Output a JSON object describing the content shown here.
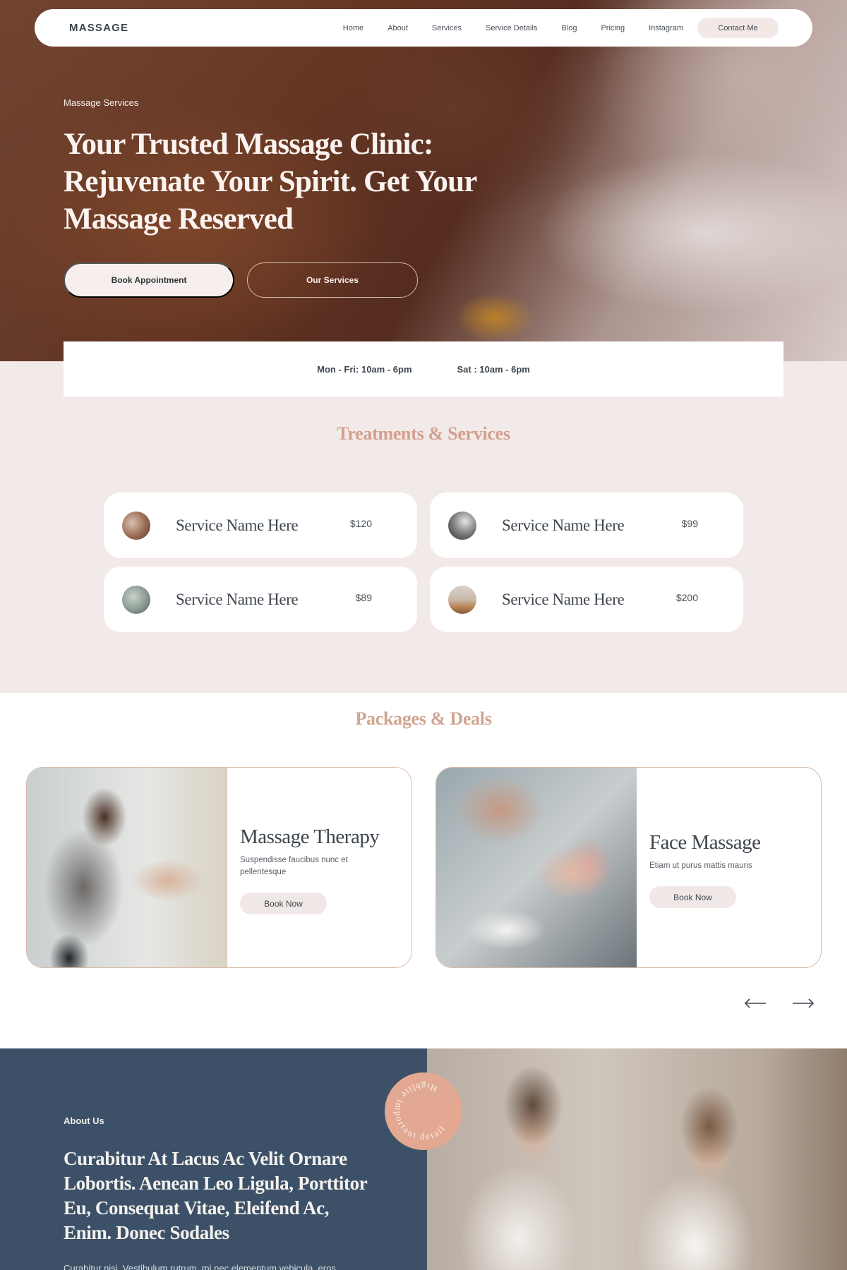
{
  "nav": {
    "logo": "MASSAGE",
    "links": [
      "Home",
      "About",
      "Services",
      "Service Details",
      "Blog",
      "Pricing",
      "Instagram"
    ],
    "contact_label": "Contact Me"
  },
  "hero": {
    "eyebrow": "Massage Services",
    "title": "Your Trusted Massage Clinic: Rejuvenate Your Spirit. Get Your Massage Reserved",
    "primary_button": "Book Appointment",
    "secondary_button": "Our Services"
  },
  "hours": {
    "weekday": "Mon - Fri: 10am - 6pm",
    "saturday": "Sat : 10am - 6pm"
  },
  "treatments": {
    "title": "Treatments & Services",
    "items": [
      {
        "name": "Service Name Here",
        "price": "$120",
        "thumb_color": "#9a6a52"
      },
      {
        "name": "Service Name Here",
        "price": "$99",
        "thumb_color": "#5d5f62"
      },
      {
        "name": "Service Name Here",
        "price": "$89",
        "thumb_color": "#8a9a92"
      },
      {
        "name": "Service Name Here",
        "price": "$200",
        "thumb_color": "#b98455"
      }
    ]
  },
  "packages": {
    "title": "Packages & Deals",
    "items": [
      {
        "name": "Massage Therapy",
        "description": "Suspendisse faucibus nunc et pellentesque",
        "button": "Book Now"
      },
      {
        "name": "Face Massage",
        "description": "Etiam ut purus mattis mauris",
        "button": "Book Now"
      }
    ],
    "prev_icon": "arrow-left-icon",
    "next_icon": "arrow-right-icon"
  },
  "about": {
    "eyebrow": "About Us",
    "title": "Curabitur At Lacus Ac Velit Ornare Lobortis. Aenean Leo Ligula, Porttitor Eu, Consequat Vitae, Eleifend Ac, Enim. Donec Sodales",
    "body": "Curabitur nisi. Vestibulum rutrum, mi nec elementum vehicula, eros",
    "badge_text": "Highlite important detail"
  },
  "colors": {
    "accent_pink": "#d4a08e",
    "section_bg": "#f2eae8",
    "about_bg": "#3c5168",
    "badge": "#e2a891"
  }
}
